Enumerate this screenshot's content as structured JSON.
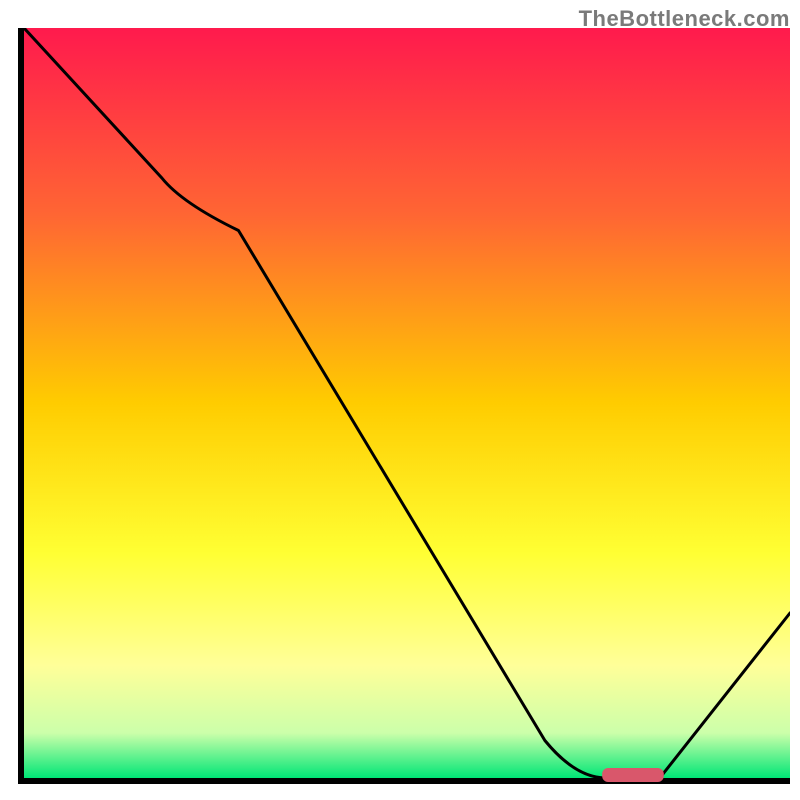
{
  "watermark": "TheBottleneck.com",
  "chart_data": {
    "type": "line",
    "title": "",
    "xlabel": "",
    "ylabel": "",
    "xlim": [
      0,
      100
    ],
    "ylim": [
      0,
      100
    ],
    "grid": false,
    "legend": false,
    "background_gradient": {
      "stops": [
        {
          "offset": 0.0,
          "color": "#ff1a4d"
        },
        {
          "offset": 0.25,
          "color": "#ff6633"
        },
        {
          "offset": 0.5,
          "color": "#ffcc00"
        },
        {
          "offset": 0.7,
          "color": "#ffff33"
        },
        {
          "offset": 0.85,
          "color": "#ffff99"
        },
        {
          "offset": 0.94,
          "color": "#ccffaa"
        },
        {
          "offset": 1.0,
          "color": "#00e676"
        }
      ]
    },
    "series": [
      {
        "name": "bottleneck-curve",
        "x": [
          0,
          18,
          28,
          68,
          76,
          83,
          100
        ],
        "values": [
          100,
          80,
          73,
          5,
          0,
          0,
          22
        ]
      }
    ],
    "marker": {
      "name": "optimal-range",
      "x_start": 76,
      "x_end": 83,
      "y": 0,
      "color": "#d9576b"
    }
  }
}
